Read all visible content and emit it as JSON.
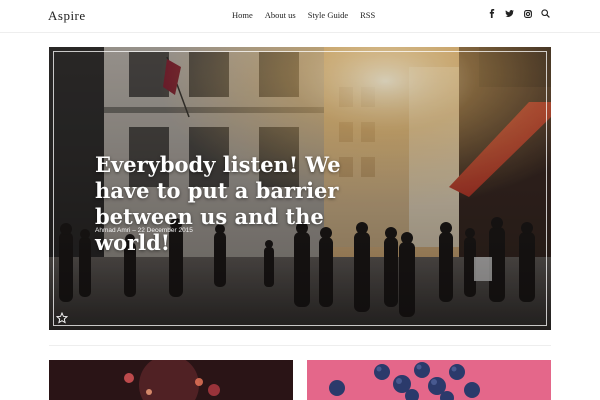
{
  "header": {
    "logo": "Aspire",
    "nav": [
      "Home",
      "About us",
      "Style Guide",
      "RSS"
    ],
    "icons": [
      "facebook-icon",
      "twitter-icon",
      "instagram-icon",
      "search-icon"
    ]
  },
  "hero": {
    "title": "Everybody listen! We have to put a barrier between us and the world!",
    "meta": "Ahmad Amri – 22 December 2015",
    "featured_icon": "star-icon"
  },
  "cards": [
    {
      "image": "city-lights-photo"
    },
    {
      "image": "blueberries-on-pink-photo"
    }
  ]
}
